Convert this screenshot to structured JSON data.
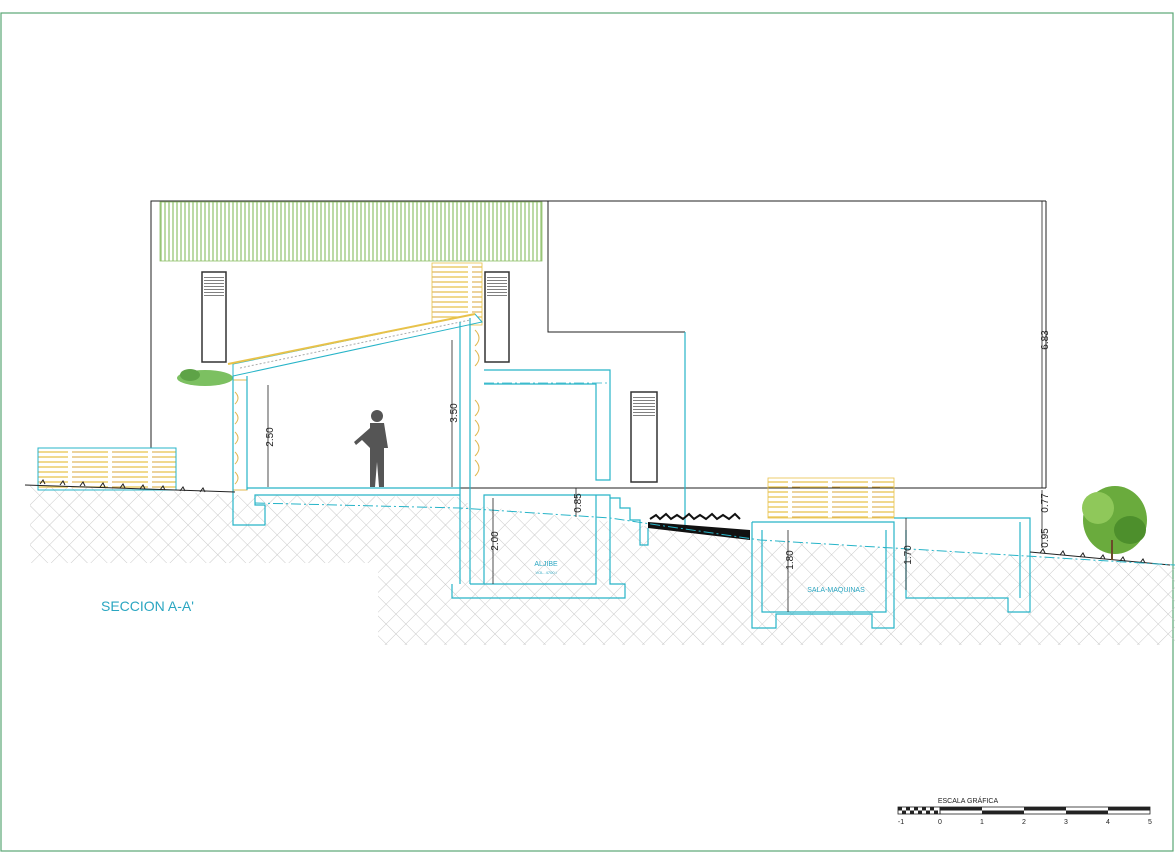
{
  "drawing": {
    "section_title": "SECCION A-A'",
    "rooms": {
      "aljibe": "ALJIBE",
      "aljibe_note": "VOL. 4700 l",
      "sala_maquinas": "SALA-MAQUINAS"
    },
    "dimensions": {
      "total_height": "6.83",
      "room_height": "3.50",
      "inner_height": "2.50",
      "aljibe_depth": "2.00",
      "aljibe_offset": "0.85",
      "maquinas_inner": "1.80",
      "pit_height": "1.70",
      "step_upper": "0.77",
      "step_lower": "0.95"
    },
    "scale_bar": {
      "title": "ESCALA GRÁFICA",
      "ticks": [
        "-1",
        "0",
        "1",
        "2",
        "3",
        "4",
        "5"
      ]
    },
    "colors": {
      "frame": "#5aa774",
      "cyan": "#27b4c8",
      "wood": "#e8c24a",
      "roof": "#8fc06a",
      "ground": "#c8c8c8",
      "text_cyan": "#2aa6c1"
    }
  }
}
